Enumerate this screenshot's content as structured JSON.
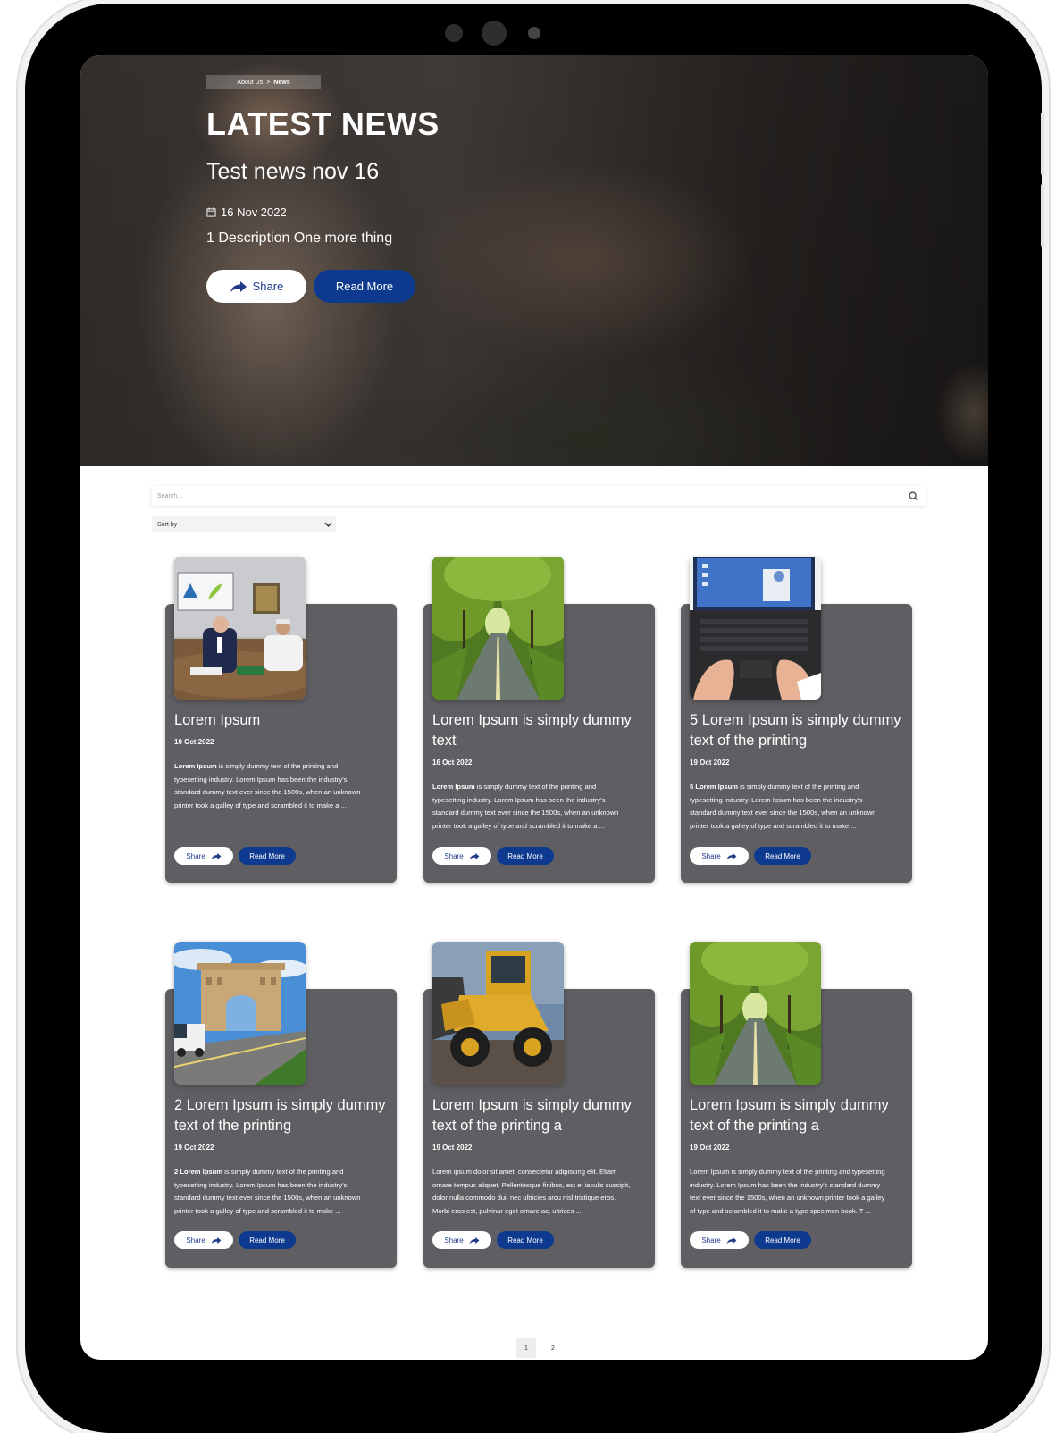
{
  "breadcrumb": {
    "parent": "About Us",
    "separator": ">",
    "current": "News"
  },
  "hero": {
    "title": "LATEST NEWS",
    "subtitle": "Test news nov 16",
    "date": "16 Nov 2022",
    "description": "1 Description One more thing",
    "share_label": "Share",
    "read_more_label": "Read More"
  },
  "search": {
    "placeholder": "Search..."
  },
  "sort": {
    "label": "Sort by"
  },
  "cards": [
    {
      "title_lines": [
        "Lorem Ipsum"
      ],
      "date": "10 Oct 2022",
      "excerpt_bold": "Lorem Ipsum",
      "excerpt_lines": [
        " is simply dummy text of the printing and",
        "typesetting industry. Lorem Ipsum has been the industry's",
        "standard dummy text ever since the 1500s, when an unknown",
        "printer took a galley of type and scrambled it to make a ..."
      ],
      "share_label": "Share",
      "read_more_label": "Read More",
      "image": "office-meeting"
    },
    {
      "title_lines": [
        "Lorem Ipsum is simply dummy",
        "text"
      ],
      "date": "16 Oct 2022",
      "excerpt_bold": "Lorem Ipsum",
      "excerpt_lines": [
        " is simply dummy text of the printing and",
        "typesetting industry. Lorem Ipsum has been the industry's",
        "standard dummy text ever since the 1500s, when an unknown",
        "printer took a galley of type and scrambled it to make a ..."
      ],
      "share_label": "Share",
      "read_more_label": "Read More",
      "image": "tree-road"
    },
    {
      "title_lines": [
        "5 Lorem Ipsum is simply dummy",
        "text of the printing"
      ],
      "date": "19 Oct 2022",
      "excerpt_bold": "5 Lorem Ipsum",
      "excerpt_lines": [
        " is simply dummy text of the printing and",
        "typesetting industry. Lorem Ipsum has been the industry's",
        "standard dummy text ever since the 1500s, when an unknown",
        "printer took a galley of type and scrambled it to make ..."
      ],
      "share_label": "Share",
      "read_more_label": "Read More",
      "image": "laptop-typing"
    },
    {
      "title_lines": [
        "2 Lorem Ipsum is simply dummy",
        "text of the printing"
      ],
      "date": "19 Oct 2022",
      "excerpt_bold": "2 Lorem Ipsum",
      "excerpt_lines": [
        " is simply dummy text of the printing and",
        "typesetting industry. Lorem Ipsum has been the industry's",
        "standard dummy text ever since the 1500s, when an unknown",
        "printer took a galley of type and scrambled it to make ..."
      ],
      "share_label": "Share",
      "read_more_label": "Read More",
      "image": "gate-road"
    },
    {
      "title_lines": [
        "Lorem Ipsum is simply dummy",
        "text of the printing a"
      ],
      "date": "19 Oct 2022",
      "excerpt_bold": "",
      "excerpt_lines": [
        "Lorem ipsum dolor sit amet, consectetur adipiscing elit. Etiam",
        "ornare tempus aliquet. Pellentesque finibus, est et iaculis suscipit,",
        "dolor nulla commodo dui, nec ultricies arcu nisl tristique eros.",
        "Morbi eros est, pulvinar eget ornare ac, ultrices ..."
      ],
      "share_label": "Share",
      "read_more_label": "Read More",
      "image": "wheel-loader"
    },
    {
      "title_lines": [
        "Lorem Ipsum is simply dummy",
        "text of the printing a"
      ],
      "date": "19 Oct 2022",
      "excerpt_bold": "",
      "excerpt_lines": [
        "Lorem Ipsum is simply dummy text of the printing and typesetting",
        "industry. Lorem Ipsum has been the industry's standard dummy",
        "text ever since the 1500s, when an unknown printer took a galley",
        "of type and scrambled it to make a type specimen book. T ..."
      ],
      "share_label": "Share",
      "read_more_label": "Read More",
      "image": "tree-road"
    }
  ],
  "pagination": {
    "pages": [
      "1",
      "2"
    ],
    "active": "1"
  },
  "colors": {
    "primary": "#0d3a8f",
    "card_bg": "#5f5f63",
    "hero_text": "#ffffff"
  }
}
